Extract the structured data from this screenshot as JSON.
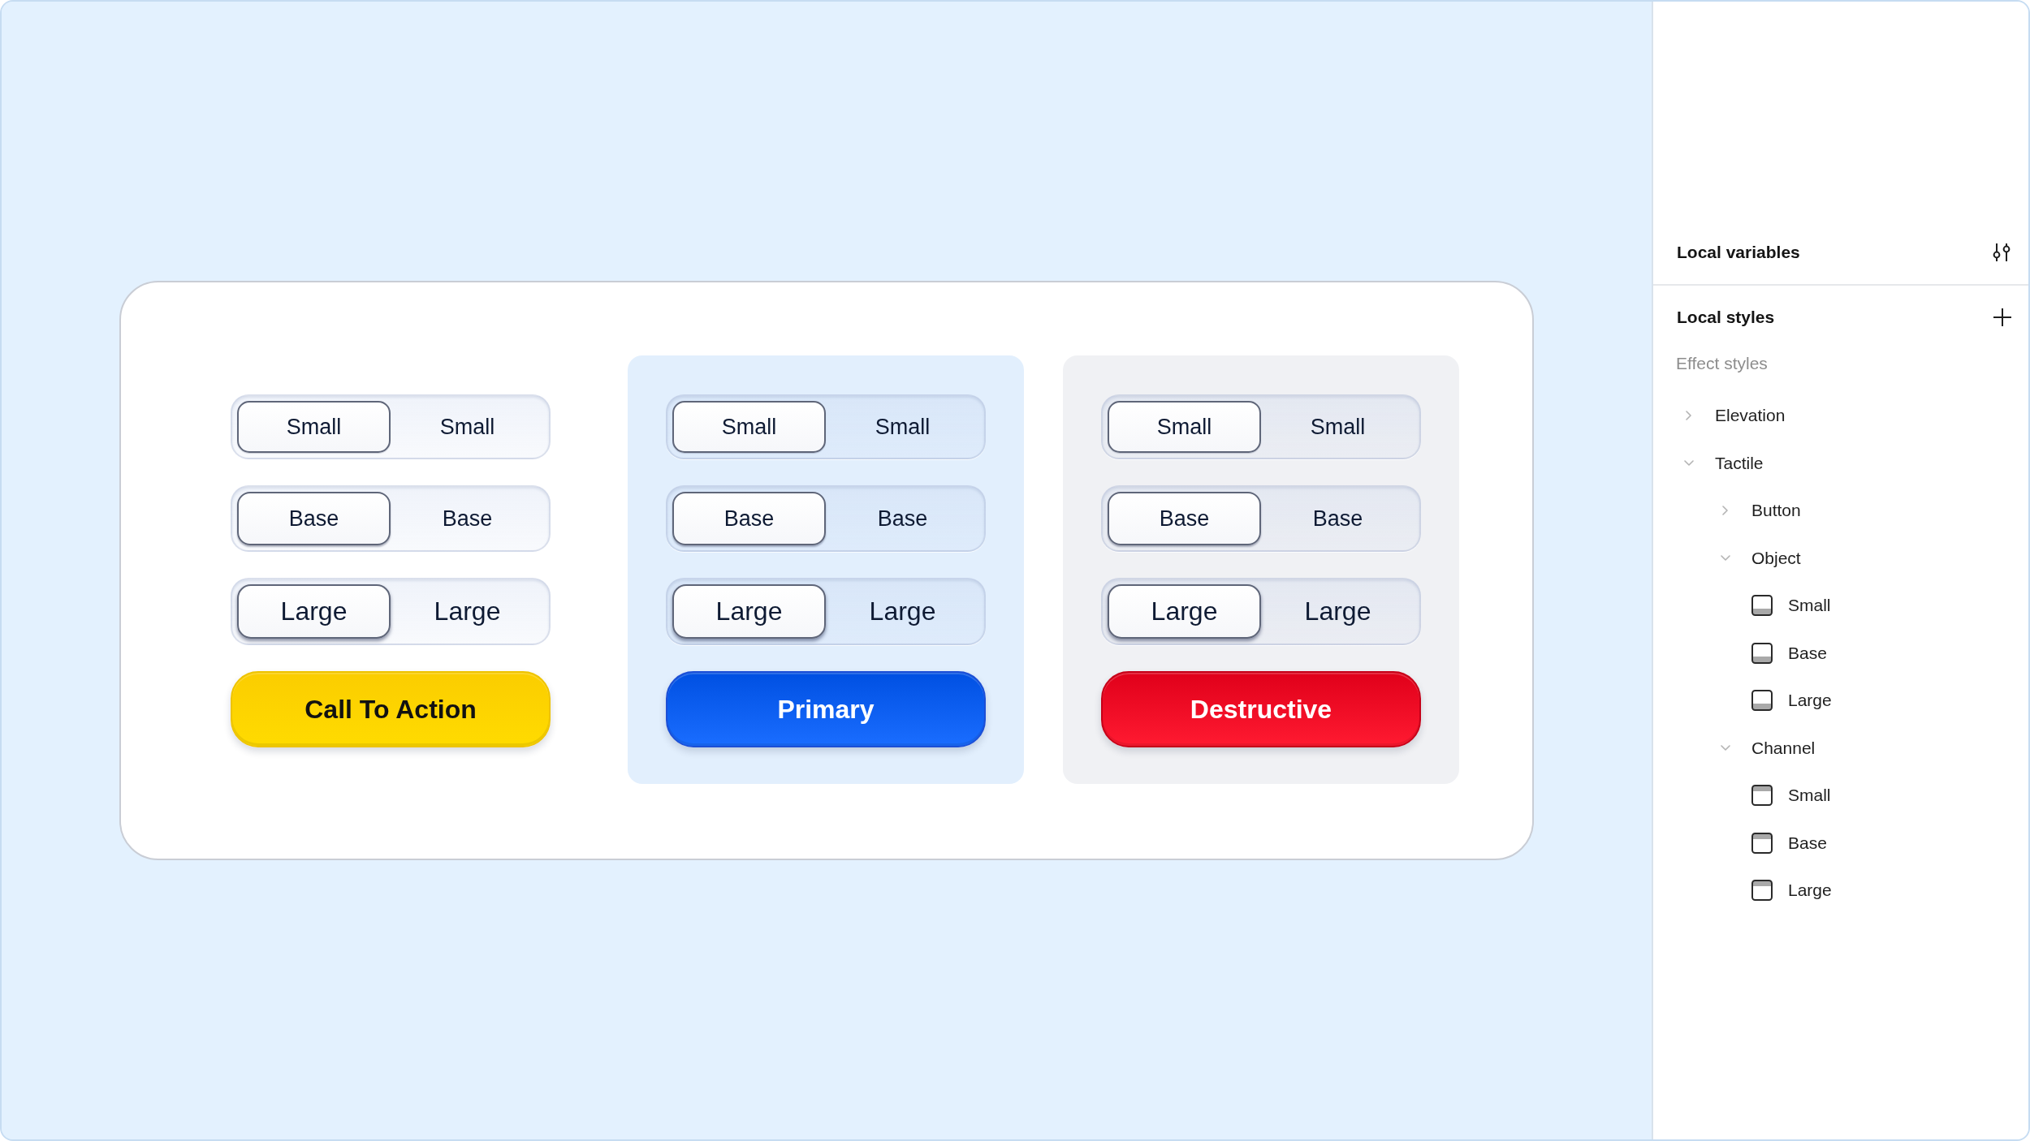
{
  "canvas": {
    "columns": [
      {
        "kind": "cta",
        "segments": [
          {
            "kind": "small",
            "options": [
              {
                "label": "Small",
                "selected": true
              },
              {
                "label": "Small",
                "selected": false
              }
            ]
          },
          {
            "kind": "base",
            "options": [
              {
                "label": "Base",
                "selected": true
              },
              {
                "label": "Base",
                "selected": false
              }
            ]
          },
          {
            "kind": "large",
            "options": [
              {
                "label": "Large",
                "selected": true
              },
              {
                "label": "Large",
                "selected": false
              }
            ]
          }
        ],
        "action": "Call To Action"
      },
      {
        "kind": "primary",
        "segments": [
          {
            "kind": "small",
            "options": [
              {
                "label": "Small",
                "selected": true
              },
              {
                "label": "Small",
                "selected": false
              }
            ]
          },
          {
            "kind": "base",
            "options": [
              {
                "label": "Base",
                "selected": true
              },
              {
                "label": "Base",
                "selected": false
              }
            ]
          },
          {
            "kind": "large",
            "options": [
              {
                "label": "Large",
                "selected": true
              },
              {
                "label": "Large",
                "selected": false
              }
            ]
          }
        ],
        "action": "Primary"
      },
      {
        "kind": "destructive",
        "segments": [
          {
            "kind": "small",
            "options": [
              {
                "label": "Small",
                "selected": true
              },
              {
                "label": "Small",
                "selected": false
              }
            ]
          },
          {
            "kind": "base",
            "options": [
              {
                "label": "Base",
                "selected": true
              },
              {
                "label": "Base",
                "selected": false
              }
            ]
          },
          {
            "kind": "large",
            "options": [
              {
                "label": "Large",
                "selected": true
              },
              {
                "label": "Large",
                "selected": false
              }
            ]
          }
        ],
        "action": "Destructive"
      }
    ]
  },
  "sidebar": {
    "variables_title": "Local variables",
    "styles_title": "Local styles",
    "category": "Effect styles",
    "tree": [
      {
        "label": "Elevation",
        "kind": "group",
        "expanded": false
      },
      {
        "label": "Tactile",
        "kind": "group",
        "expanded": true,
        "children": [
          {
            "label": "Button",
            "kind": "group",
            "expanded": false
          },
          {
            "label": "Object",
            "kind": "group",
            "expanded": true,
            "children": [
              {
                "label": "Small",
                "kind": "dropshadow"
              },
              {
                "label": "Base",
                "kind": "dropshadow"
              },
              {
                "label": "Large",
                "kind": "dropshadow"
              }
            ]
          },
          {
            "label": "Channel",
            "kind": "group",
            "expanded": true,
            "children": [
              {
                "label": "Small",
                "kind": "innershadow"
              },
              {
                "label": "Base",
                "kind": "innershadow"
              },
              {
                "label": "Large",
                "kind": "innershadow"
              }
            ]
          }
        ]
      }
    ]
  }
}
